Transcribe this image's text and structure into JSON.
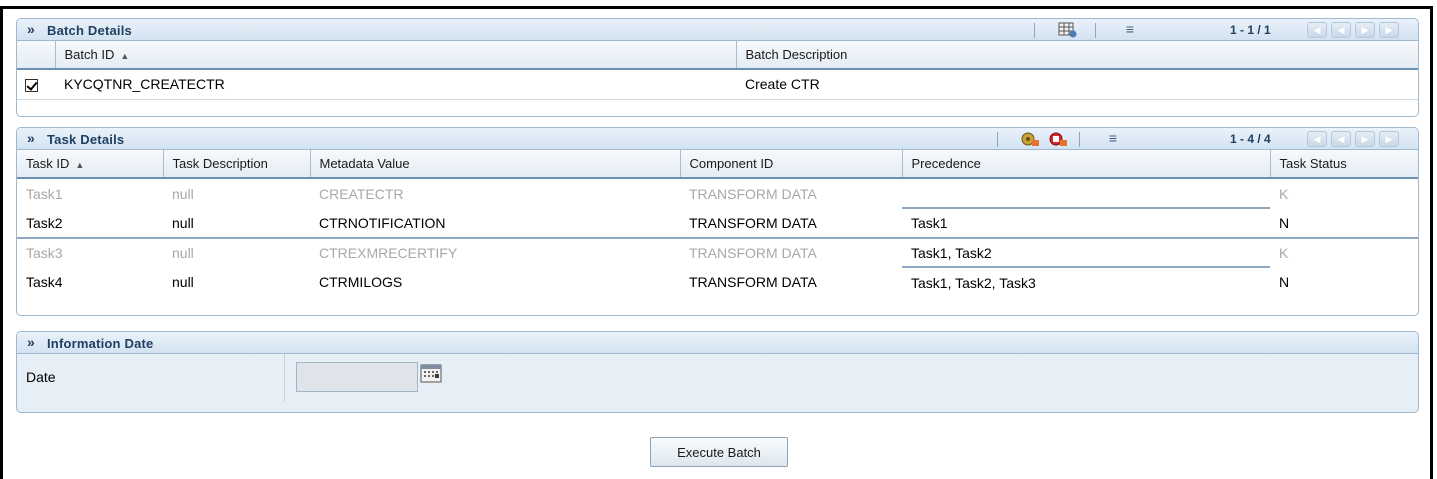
{
  "batch_details": {
    "title": "Batch Details",
    "pager": "1 - 1 / 1",
    "columns": {
      "batch_id": "Batch ID",
      "batch_description": "Batch Description"
    },
    "rows": [
      {
        "batch_id": "KYCQTNR_CREATECTR",
        "description": "Create CTR",
        "checked": true
      }
    ]
  },
  "task_details": {
    "title": "Task Details",
    "pager": "1 - 4 / 4",
    "columns": {
      "task_id": "Task ID",
      "task_description": "Task Description",
      "metadata_value": "Metadata Value",
      "component_id": "Component ID",
      "precedence": "Precedence",
      "task_status": "Task Status"
    },
    "rows": [
      {
        "task_id": "Task1",
        "description": "null",
        "metadata": "CREATECTR",
        "component": "TRANSFORM DATA",
        "precedence": "",
        "status": "K",
        "dimmed": true
      },
      {
        "task_id": "Task2",
        "description": "null",
        "metadata": "CTRNOTIFICATION",
        "component": "TRANSFORM DATA",
        "precedence": "Task1",
        "status": "N",
        "dimmed": false
      },
      {
        "task_id": "Task3",
        "description": "null",
        "metadata": "CTREXMRECERTIFY",
        "component": "TRANSFORM DATA",
        "precedence": "Task1, Task2",
        "status": "K",
        "dimmed": true
      },
      {
        "task_id": "Task4",
        "description": "null",
        "metadata": "CTRMILOGS",
        "component": "TRANSFORM DATA",
        "precedence": "Task1, Task2, Task3",
        "status": "N",
        "dimmed": false
      }
    ]
  },
  "information_date": {
    "title": "Information Date",
    "date_label": "Date",
    "date_value": ""
  },
  "actions": {
    "execute_label": "Execute Batch"
  },
  "icons": {
    "collapse": "chevron-double-right-icon",
    "menu": "menu-lines-icon",
    "first": "first-page-icon",
    "prev": "previous-page-icon",
    "next": "next-page-icon",
    "last": "last-page-icon",
    "calendar": "calendar-icon",
    "run": "run-icon",
    "stop": "stop-icon",
    "table": "table-view-icon"
  },
  "colors": {
    "header_text": "#1f3f63",
    "header_bg": "#d3e2f1",
    "border": "#9fb7cf",
    "dim_text": "#a8a8a8"
  }
}
